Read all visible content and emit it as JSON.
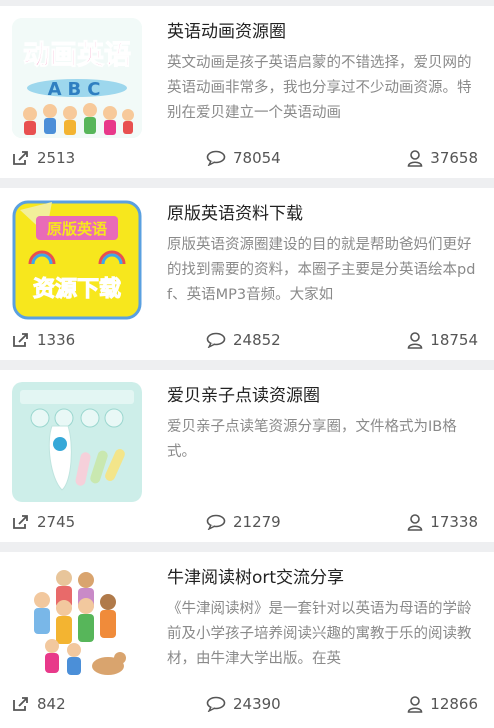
{
  "cards": [
    {
      "title": "英语动画资源圈",
      "desc": "英文动画是孩子英语启蒙的不错选择，爱贝网的英语动画非常多，我也分享过不少动画资源。特别在爱贝建立一个英语动画",
      "shares": "2513",
      "comments": "78054",
      "members": "37658",
      "thumb_text_1": "动画英语",
      "thumb_text_2": "ABC"
    },
    {
      "title": "原版英语资料下载",
      "desc": "原版英语资源圈建设的目的就是帮助爸妈们更好的找到需要的资料，本圈子主要是分英语绘本pdf、英语MP3音频。大家如",
      "shares": "1336",
      "comments": "24852",
      "members": "18754",
      "thumb_text_1": "原版英语",
      "thumb_text_2": "资源下载"
    },
    {
      "title": "爱贝亲子点读资源圈",
      "desc": "爱贝亲子点读笔资源分享圈，文件格式为IB格式。",
      "shares": "2745",
      "comments": "21279",
      "members": "17338"
    },
    {
      "title": "牛津阅读树ort交流分享",
      "desc": "《牛津阅读树》是一套针对以英语为母语的学龄前及小学孩子培养阅读兴趣的寓教于乐的阅读教材，由牛津大学出版。在英",
      "shares": "842",
      "comments": "24390",
      "members": "12866"
    }
  ],
  "colors": {
    "background": "#eeeff1",
    "card": "#ffffff",
    "title": "#222222",
    "desc": "#8a8a8a"
  }
}
